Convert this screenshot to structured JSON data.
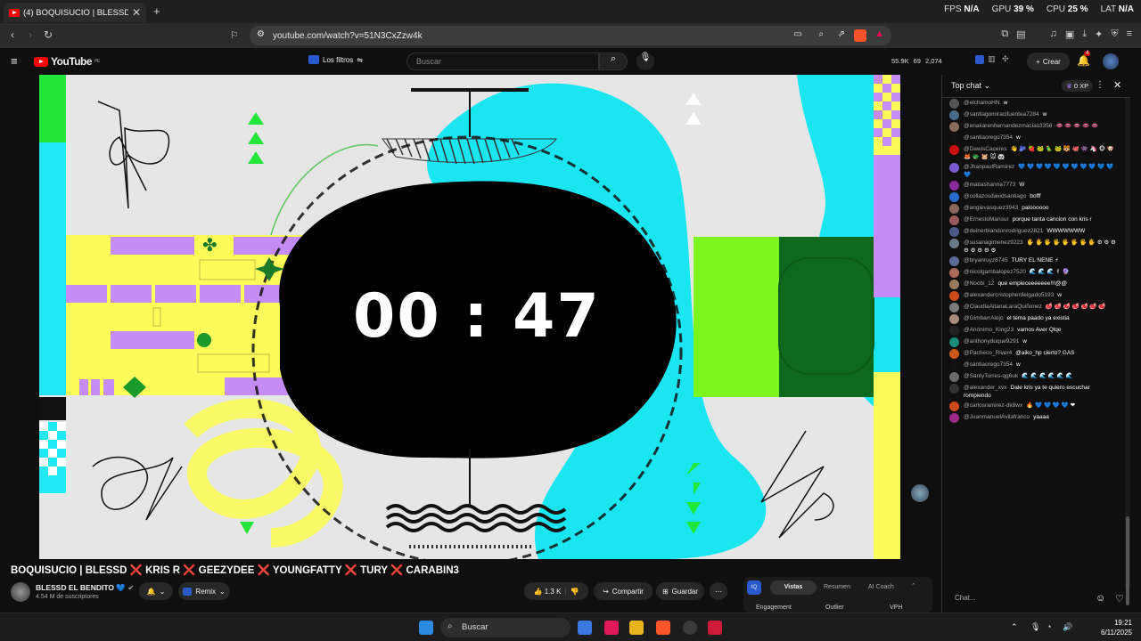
{
  "browser": {
    "tab_title": "(4) BOQUISUCIO | BLESSD ❌",
    "url": "youtube.com/watch?v=51N3CxZzw4k",
    "stats": [
      {
        "label": "FPS",
        "value": "N/A"
      },
      {
        "label": "GPU",
        "value": "39 %"
      },
      {
        "label": "CPU",
        "value": "25 %"
      },
      {
        "label": "LAT",
        "value": "N/A"
      }
    ]
  },
  "youtube": {
    "logo_text": "YouTube",
    "region": "PE",
    "filters_label": "Los filtros",
    "search_placeholder": "Buscar",
    "counts": [
      "55.9K",
      "69",
      "2,074"
    ],
    "create_label": "Crear",
    "notification_count": "4"
  },
  "video": {
    "timer": "00 : 47",
    "title": "BOQUISUCIO | BLESSD ❌ KRIS R ❌ GEEZYDEE ❌ YOUNGFATTY ❌ TURY ❌ CARABIN3",
    "channel": "BLESSD EL BENDITO 💙",
    "subscribers": "4.54 M de suscriptores",
    "remix_label": "Remix",
    "likes": "1.3 K",
    "share_label": "Compartir",
    "save_label": "Guardar"
  },
  "analytics": {
    "tabs": [
      "Vistas",
      "Resumen",
      "AI Coach"
    ],
    "columns": [
      "Engagement",
      "Outlier",
      "VPH"
    ]
  },
  "chat": {
    "mode_label": "Top chat",
    "xp_label": "0 XP",
    "input_placeholder": "Chat...",
    "messages": [
      {
        "user": "@elchamoHN",
        "text": "w",
        "color": "#555"
      },
      {
        "user": "@santiagomiracifuentea7284",
        "text": "w",
        "color": "#4a6a8a"
      },
      {
        "user": "@enakarenhernandezmacias3356",
        "text": "👄 👄 👄 👄 👄",
        "color": "#8a6a5a"
      },
      {
        "user": "@santiaorego7354",
        "text": "w",
        "color": "#111"
      },
      {
        "user": "@DawisCaceres",
        "text": "👋 🫐 🍓 🐸 🦜 🐸 🐯 🐙 👾 🦄 🐵 🐶 🦊 🐲 🐹 🐭 🐼",
        "color": "#cc1010"
      },
      {
        "user": "@JhanpaulRamirez",
        "text": "💙 💙 💙 💙 💙 💙 💙 💙 💙 💙 💙 💙",
        "color": "#7a5acc"
      },
      {
        "user": "@matiashanna7773",
        "text": "W",
        "color": "#8a2a9a"
      },
      {
        "user": "@collazosdavidsantiago",
        "text": "bofff",
        "color": "#2a6acc"
      },
      {
        "user": "@angievasquez3943",
        "text": "paloooooo",
        "color": "#8a6a5a"
      },
      {
        "user": "@ErnestoMansur",
        "text": "porque tanta cancion con kris r",
        "color": "#9a5a5a"
      },
      {
        "user": "@deinerblandonrodriguez2821",
        "text": "WWWWWWW",
        "color": "#4a5a8a"
      },
      {
        "user": "@susanagimenez9223",
        "text": "🖐 🖐 🖐 🖐 🖐 🖐 🖐 🖐 ⚙ ⚙ ⚙ ⚙ ⚙ ⚙ ⚙ ⚙",
        "color": "#6a7a8a"
      },
      {
        "user": "@bryanruyz8745",
        "text": "TURY EL NENE ⚡",
        "color": "#5a6a9a"
      },
      {
        "user": "@nicolgambalopez7520",
        "text": "🌊 🌊 🌊 ✌ 🔮",
        "color": "#aa6a5a"
      },
      {
        "user": "@Noobi_12",
        "text": "que empieceeeeeee!!!@@",
        "color": "#9a7a5a"
      },
      {
        "user": "@alexandercristopherdelgado5193",
        "text": "w",
        "color": "#cc4a1a"
      },
      {
        "user": "@ClaudiaAitanaLaraQuiñonez",
        "text": "🥩 🥩 🥩 🥩 🥩 🥩 🥩",
        "color": "#7a7a7a"
      },
      {
        "user": "@GimbarrAlejo",
        "text": "el tema paado ya existia",
        "color": "#aa8a7a"
      },
      {
        "user": "@Anónimo_King23",
        "text": "vamos Aver Qlqe",
        "color": "#222"
      },
      {
        "user": "@anthonyduque9291",
        "text": "w",
        "color": "#1a8a7a"
      },
      {
        "user": "@Pacheco_River4",
        "text": "@aiko_hp cierto? GAS",
        "color": "#cc5a1a"
      },
      {
        "user": "@santiaorego7354",
        "text": "w",
        "color": "#111"
      },
      {
        "user": "@SantyTorres-qg6uk",
        "text": "🌊 🌊 🌊 🌊 🌊 🌊",
        "color": "#6a6a6a"
      },
      {
        "user": "@alexander_xvx",
        "text": "Dale kris ya te quiero escuchar rompiendo",
        "color": "#333"
      },
      {
        "user": "@carlosramirez-dk8wx",
        "text": "🔥 💙 💙 💙 💙 ❤",
        "color": "#cc4a1a"
      },
      {
        "user": "@JuanmanuelÁvilafranco",
        "text": "yaaaa",
        "color": "#9a2a8a"
      }
    ]
  },
  "taskbar": {
    "search_label": "Buscar",
    "time": "19:21",
    "date": "6/11/2025"
  }
}
